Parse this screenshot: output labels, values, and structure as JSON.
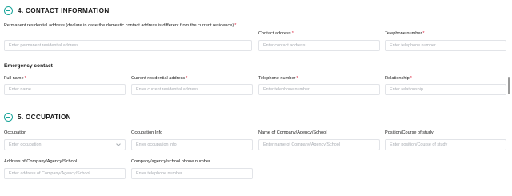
{
  "sections": {
    "contact": {
      "title": "4. CONTACT INFORMATION"
    },
    "occupation": {
      "title": "5. OCCUPATION"
    }
  },
  "contact": {
    "permanent_address": {
      "label": "Permanent residential address (declare in case the domestic contact address is different from the current residence)",
      "placeholder": "Enter permanent residential address",
      "required": "*"
    },
    "contact_address": {
      "label": "Contact address",
      "placeholder": "Enter contact address",
      "required": "*"
    },
    "telephone": {
      "label": "Telephone number",
      "placeholder": "Enter telephone number",
      "required": "*"
    }
  },
  "emergency": {
    "heading": "Emergency contact",
    "full_name": {
      "label": "Full name",
      "placeholder": "Enter name",
      "required": "*"
    },
    "current_address": {
      "label": "Current residential address",
      "placeholder": "Enter current residential address",
      "required": "*"
    },
    "telephone": {
      "label": "Telephone number",
      "placeholder": "Enter telephone number",
      "required": "*"
    },
    "relationship": {
      "label": "Relationship",
      "placeholder": "Enter relationship",
      "required": "*"
    }
  },
  "occupation": {
    "occupation": {
      "label": "Occupation",
      "placeholder": "Enter occupation"
    },
    "occupation_info": {
      "label": "Occupation Info",
      "placeholder": "Enter occupation info"
    },
    "company_name": {
      "label": "Name of Company/Agency/School",
      "placeholder": "Enter name of Company/Agency/School"
    },
    "position": {
      "label": "Position/Course of study",
      "placeholder": "Enter position/Course of study"
    },
    "company_address": {
      "label": "Address of Company/Agency/School",
      "placeholder": "Enter address of Company/Agency/School"
    },
    "company_phone": {
      "label": "Company/agency/school phone number",
      "placeholder": "Enter telephone number"
    }
  },
  "colors": {
    "accent": "#1aa59a",
    "required": "#e0334c",
    "border": "#e2e4e8",
    "placeholder": "#a9adb3"
  },
  "icons": {
    "section_toggle": "minus-circle-icon",
    "dropdown": "chevron-down-icon"
  }
}
